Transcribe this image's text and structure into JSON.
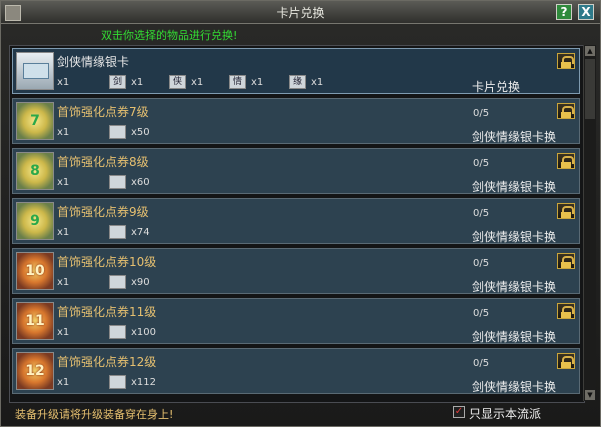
{
  "window": {
    "title": "卡片兑换",
    "help_label": "?",
    "close_label": "X"
  },
  "hint": "双击你选择的物品进行兑换!",
  "rows": [
    {
      "name": "剑侠情缘银卡",
      "icon": "silver-card-icon",
      "badge": "",
      "qty": "x1",
      "mats": [
        {
          "glyph": "剑",
          "qty": "x1"
        },
        {
          "glyph": "侠",
          "qty": "x1"
        },
        {
          "glyph": "情",
          "qty": "x1"
        },
        {
          "glyph": "缘",
          "qty": "x1"
        }
      ],
      "progress": "",
      "action": "卡片兑换"
    },
    {
      "name": "首饰强化点券7级",
      "icon": "voucher-icon",
      "badge": "7",
      "qty": "x1",
      "mat_qty": "x50",
      "progress": "0/5",
      "action": "剑侠情缘银卡换"
    },
    {
      "name": "首饰强化点券8级",
      "icon": "voucher-icon",
      "badge": "8",
      "qty": "x1",
      "mat_qty": "x60",
      "progress": "0/5",
      "action": "剑侠情缘银卡换"
    },
    {
      "name": "首饰强化点券9级",
      "icon": "voucher-icon",
      "badge": "9",
      "qty": "x1",
      "mat_qty": "x74",
      "progress": "0/5",
      "action": "剑侠情缘银卡换"
    },
    {
      "name": "首饰强化点券10级",
      "icon": "voucher-icon",
      "badge": "10",
      "qty": "x1",
      "mat_qty": "x90",
      "progress": "0/5",
      "action": "剑侠情缘银卡换"
    },
    {
      "name": "首饰强化点券11级",
      "icon": "voucher-icon",
      "badge": "11",
      "qty": "x1",
      "mat_qty": "x100",
      "progress": "0/5",
      "action": "剑侠情缘银卡换"
    },
    {
      "name": "首饰强化点券12级",
      "icon": "voucher-icon",
      "badge": "12",
      "qty": "x1",
      "mat_qty": "x112",
      "progress": "0/5",
      "action": "剑侠情缘银卡换"
    }
  ],
  "footer": {
    "tip": "装备升级请将升级装备穿在身上!",
    "checkbox_label": "只显示本流派",
    "checked": "✓"
  }
}
